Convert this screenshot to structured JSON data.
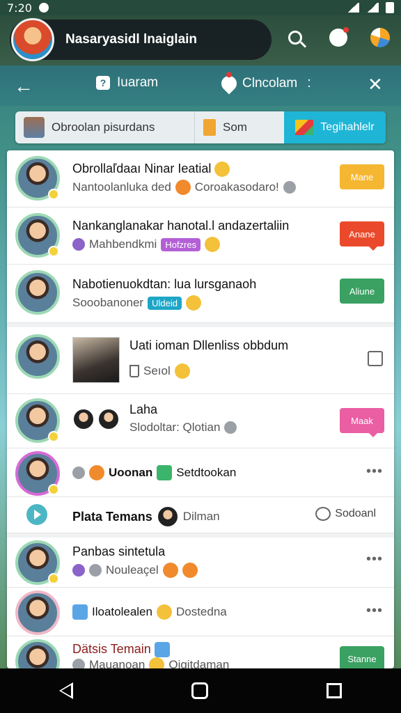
{
  "status_bar": {
    "time": "7:20"
  },
  "header": {
    "profile_name": "Nasaryasidl lnaiglain"
  },
  "subbar": {
    "left_label": "Iuaram",
    "mid_label": "Clncolam",
    "more": ":"
  },
  "tabs": [
    {
      "label": "Obroolan pisurdans"
    },
    {
      "label": "Som"
    },
    {
      "label": "Tegihahlelr"
    }
  ],
  "rows": [
    {
      "title": "Obrollaľdaaı Ninar Ieatial",
      "subtitle": "Nantoolanluka ded",
      "extra": "Coroakasodaro!",
      "pill": "Mane"
    },
    {
      "title": "Nankanglanakar hanotal.l andazertaliin",
      "subtitle": "Mahbendkmi",
      "tag": "Hofzres",
      "pill": "Anane"
    },
    {
      "title": "Nabotienuokdtan: lua lursganaoh",
      "subtitle": "Sooobanoner",
      "tag": "Uldeid",
      "pill": "Aliune"
    },
    {
      "title": "Uati ioman Dllenliss obbdum",
      "subtitle": "Seıol"
    },
    {
      "title": "Laha",
      "subtitle": "Slodoltar: Qlotian",
      "pill": "Maak"
    },
    {
      "title": "Uoonan",
      "subtitle": "Setdtookan",
      "more": "•••"
    },
    {
      "title": "Plata Temans",
      "subtitle": "Dilman",
      "action": "Sodoanl"
    },
    {
      "title": "Panbas sintetula",
      "subtitle": "Nouleaçel",
      "more": "•••"
    },
    {
      "title": "Iloatolealen",
      "subtitle": "Dostedna",
      "more": "•••"
    },
    {
      "title": "Dätsis Temain",
      "subtitle": "Mauanoan",
      "extra": "Oigitdaman",
      "pill": "Stanne"
    }
  ],
  "colors": {
    "accent": "#1fb5d6",
    "pill_yellow": "#f5b731",
    "pill_red": "#ea4a2b",
    "pill_green": "#3aa162",
    "pill_pink": "#ea5ea3"
  }
}
